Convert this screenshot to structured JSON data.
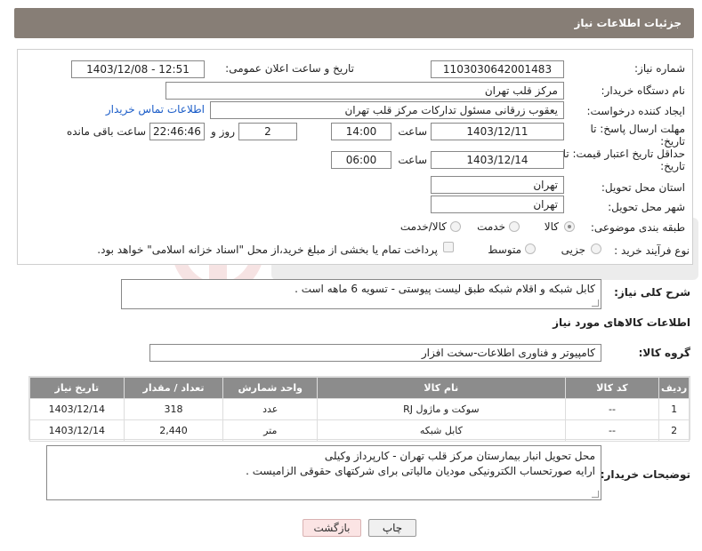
{
  "header": {
    "title": "جزئیات اطلاعات نیاز"
  },
  "form": {
    "need_number_label": "شماره نیاز:",
    "need_number": "1103030642001483",
    "announce_label": "تاریخ و ساعت اعلان عمومی:",
    "announce_value": "1403/12/08 - 12:51",
    "buyer_org_label": "نام دستگاه خریدار:",
    "buyer_org": "مرکز قلب تهران",
    "creator_label": "ایجاد کننده درخواست:",
    "creator": "یعقوب زرقانی مسئول تدارکات مرکز قلب تهران",
    "contact_link": "اطلاعات تماس خریدار",
    "reply_deadline_label_1": "مهلت ارسال پاسخ: تا",
    "reply_deadline_label_2": "تاریخ:",
    "reply_date": "1403/12/11",
    "time_label": "ساعت",
    "reply_time": "14:00",
    "days_value": "2",
    "days_label": "روز و",
    "remaining_time": "22:46:46",
    "remaining_label": "ساعت باقی مانده",
    "validity_label_1": "حداقل تاریخ اعتبار قیمت: تا",
    "validity_label_2": "تاریخ:",
    "validity_date": "1403/12/14",
    "validity_time": "06:00",
    "province_label": "استان محل تحویل:",
    "province": "تهران",
    "city_label": "شهر محل تحویل:",
    "city": "تهران",
    "category_label": "طبقه بندی موضوعی:",
    "category_options": [
      "کالا",
      "خدمت",
      "کالا/خدمت"
    ],
    "process_label": "نوع فرآیند خرید :",
    "process_options": [
      "جزیی",
      "متوسط"
    ],
    "payment_note": "پرداخت تمام یا بخشی از مبلغ خرید،از محل \"اسناد خزانه اسلامی\" خواهد بود."
  },
  "description": {
    "label": "شرح کلی نیاز:",
    "text": "کابل شبکه و اقلام شبکه طبق لیست پیوستی - تسویه 6 ماهه است ."
  },
  "goods": {
    "section_title": "اطلاعات کالاهای مورد نیاز",
    "group_label": "گروه کالا:",
    "group_value": "کامپیوتر و فناوری اطلاعات-سخت افزار",
    "columns": [
      "ردیف",
      "کد کالا",
      "نام کالا",
      "واحد شمارش",
      "تعداد / مقدار",
      "تاریخ نیاز"
    ],
    "rows": [
      {
        "index": "1",
        "code": "--",
        "name": "سوکت و ماژول RJ",
        "unit": "عدد",
        "qty": "318",
        "date": "1403/12/14"
      },
      {
        "index": "2",
        "code": "--",
        "name": "کابل شبکه",
        "unit": "متر",
        "qty": "2,440",
        "date": "1403/12/14"
      }
    ]
  },
  "buyer_notes": {
    "label": "توضیحات خریدار:",
    "line1": "محل تحویل انبار بیمارستان مرکز قلب تهران - کارپرداز وکیلی",
    "line2": "ارایه صورتحساب الکترونیکی مودیان مالیاتی برای شرکتهای حقوقی الزامیست ."
  },
  "buttons": {
    "print": "چاپ",
    "back": "بازگشت"
  },
  "colors": {
    "header_bg": "#877e76",
    "table_header_bg": "#8c8c8c",
    "link": "#1a5cc8",
    "back_button_bg": "#fbe4e4"
  }
}
